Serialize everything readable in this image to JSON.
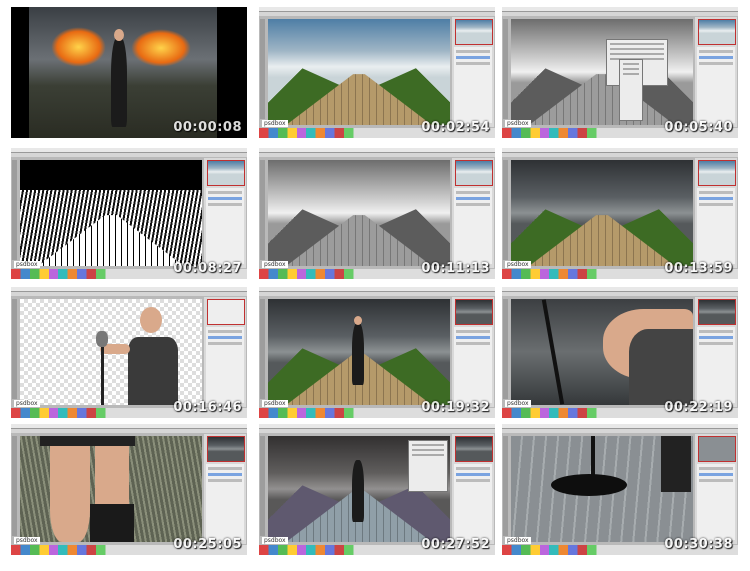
{
  "thumbnails": [
    {
      "timestamp": "00:00:08",
      "scene": "final-composite",
      "label": "Final composite with flaming wings"
    },
    {
      "timestamp": "00:02:54",
      "scene": "photoshop-cornfield-color"
    },
    {
      "timestamp": "00:05:40",
      "scene": "photoshop-bw-dialog"
    },
    {
      "timestamp": "00:08:27",
      "scene": "photoshop-threshold"
    },
    {
      "timestamp": "00:11:13",
      "scene": "photoshop-bw-sky"
    },
    {
      "timestamp": "00:13:59",
      "scene": "photoshop-dark-sky"
    },
    {
      "timestamp": "00:16:46",
      "scene": "photoshop-model-cutout"
    },
    {
      "timestamp": "00:19:32",
      "scene": "photoshop-model-placed"
    },
    {
      "timestamp": "00:22:19",
      "scene": "closeup-shoulder"
    },
    {
      "timestamp": "00:25:05",
      "scene": "closeup-legs"
    },
    {
      "timestamp": "00:27:52",
      "scene": "photoshop-toned"
    },
    {
      "timestamp": "00:30:38",
      "scene": "closeup-mic-stand"
    }
  ],
  "app_logo_text": "psdbox",
  "colors": {
    "timestamp_text": "#ffffff",
    "background": "#ffffff",
    "selection": "#7aa3e0"
  }
}
